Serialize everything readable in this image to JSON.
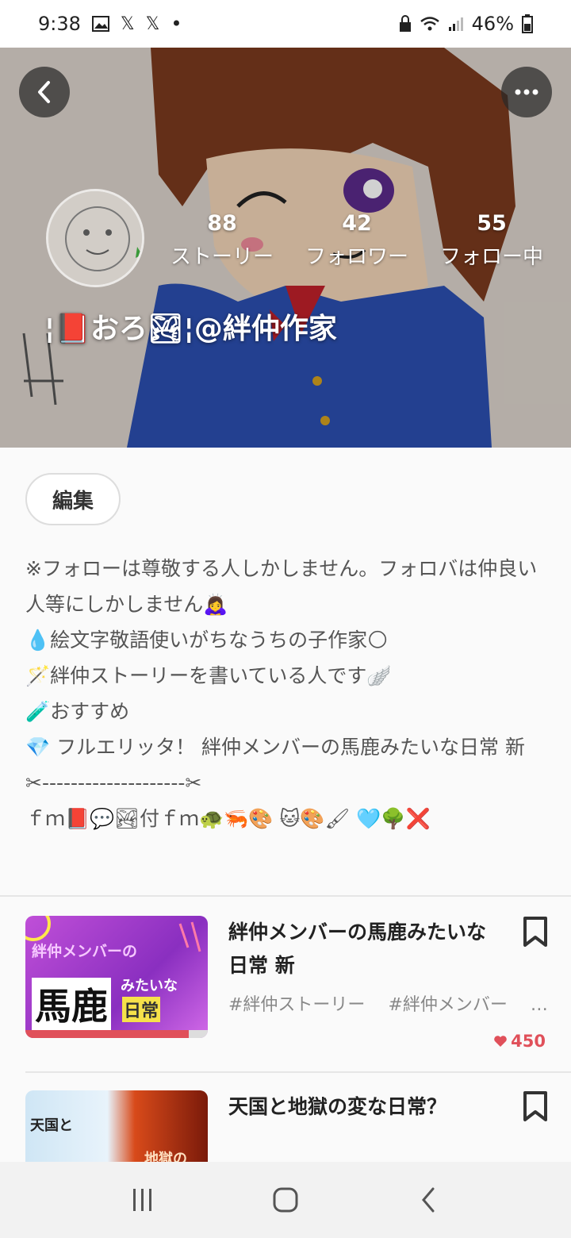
{
  "status_bar": {
    "time": "9:38",
    "battery": "46%",
    "icons": [
      "image-icon",
      "x-icon",
      "x-icon",
      "dot-icon",
      "lock-icon",
      "wifi-icon",
      "signal-icon",
      "battery-icon"
    ]
  },
  "profile": {
    "display_name": "¦📕おろ🏞¦@絆仲作家",
    "stats": [
      {
        "value": "88",
        "label": "ストーリー"
      },
      {
        "value": "42",
        "label": "フォロワー"
      },
      {
        "value": "55",
        "label": "フォロー中"
      }
    ],
    "edit_label": "編集",
    "bio": [
      "※フォローは尊敬する人しかしません。フォロバは仲良い人等にしかしません🙇‍♀️",
      "💧絵文字敬語使いがちなうちの子作家🌕",
      "🪄絆仲ストーリーを書いている人です🪽",
      "🧪おすすめ",
      "💎 フルエリッタ！ 絆仲メンバーの馬鹿みたいな日常 新",
      "✂︎--------------------✂︎",
      "ｆｍ📕💬🏞付ｆｍ🐢🦐🎨 🐱🎨🖌 🩵🌳❌"
    ]
  },
  "stories": [
    {
      "title": "絆仲メンバーの馬鹿みたいな日常 新",
      "tags": [
        "#絆仲ストーリー",
        "#絆仲メンバー",
        "…"
      ],
      "likes": "450",
      "thumb_text": {
        "line1": "絆仲メンバーの",
        "line2": "馬鹿",
        "line3": "みたいな",
        "line4": "日常"
      }
    },
    {
      "title": "天国と地獄の変な日常？",
      "thumb_text": {
        "line1": "天国と",
        "line2": "地獄の"
      }
    }
  ],
  "colors": {
    "accent_like": "#e0505a",
    "hero_hair": "#7a3a1e",
    "hero_uniform": "#2b4fb0"
  }
}
